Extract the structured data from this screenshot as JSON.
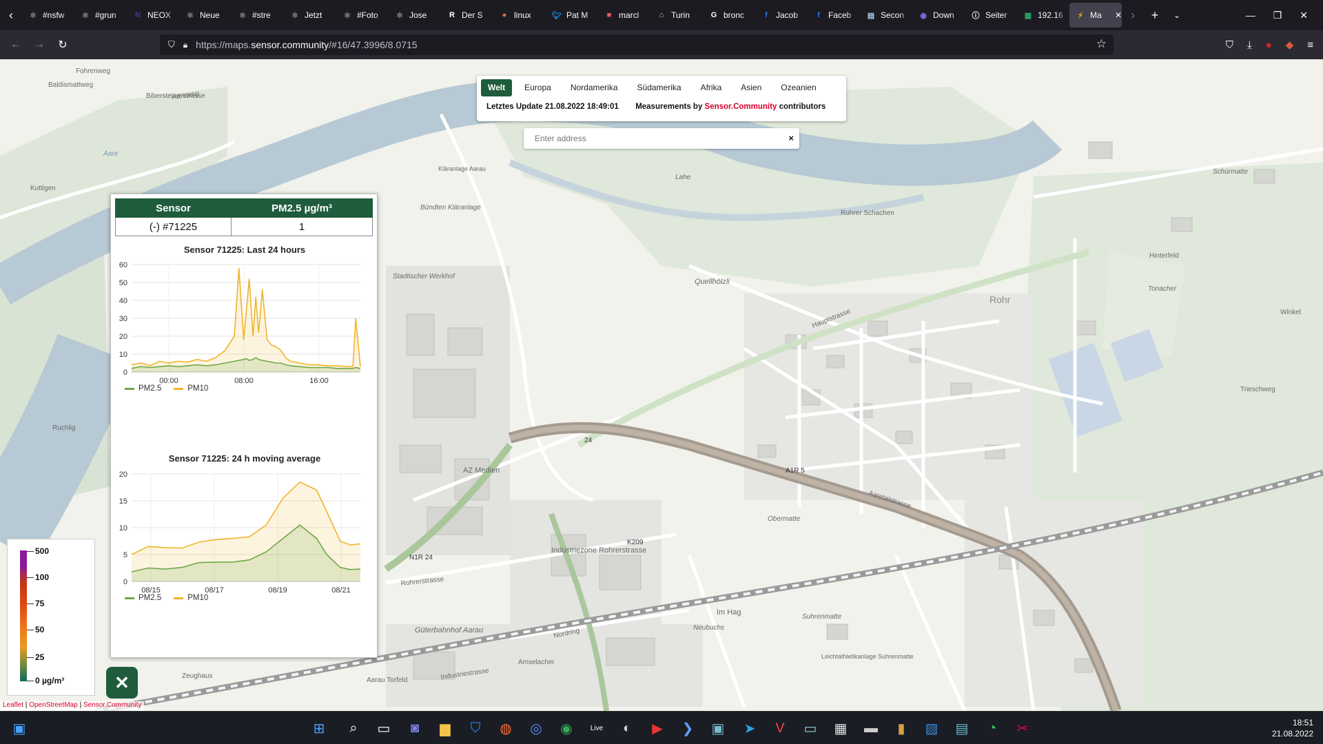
{
  "browser": {
    "tabs": [
      {
        "title": "#nsfw",
        "icon": "spark-icon",
        "color": "#6b6b6b"
      },
      {
        "title": "#grun",
        "icon": "spark-icon",
        "color": "#6b6b6b"
      },
      {
        "title": "NEOX",
        "icon": "neox-icon",
        "color": "#3a3a9a"
      },
      {
        "title": "Neue",
        "icon": "spark-icon",
        "color": "#6b6b6b"
      },
      {
        "title": "#stre",
        "icon": "spark-icon",
        "color": "#6b6b6b"
      },
      {
        "title": "Jetzt",
        "icon": "spark-icon",
        "color": "#6b6b6b"
      },
      {
        "title": "#Foto",
        "icon": "spark-icon",
        "color": "#6b6b6b"
      },
      {
        "title": "Jose",
        "icon": "spark-icon",
        "color": "#6b6b6b"
      },
      {
        "title": "Der S",
        "icon": "r-icon",
        "color": "#ffffff"
      },
      {
        "title": "linux",
        "icon": "circle-icon",
        "color": "#e8733a"
      },
      {
        "title": "Pat M",
        "icon": "twitter-icon",
        "color": "#1d9bf0"
      },
      {
        "title": "marcl",
        "icon": "square-icon",
        "color": "#e85a6a"
      },
      {
        "title": "Turin",
        "icon": "doc-icon",
        "color": "#cccccc"
      },
      {
        "title": "bronc",
        "icon": "google-icon",
        "color": "#ffffff"
      },
      {
        "title": "Jacob",
        "icon": "facebook-icon",
        "color": "#1877f2"
      },
      {
        "title": "Faceb",
        "icon": "facebook-icon",
        "color": "#1877f2"
      },
      {
        "title": "Secon",
        "icon": "page-icon",
        "color": "#a8c8e8"
      },
      {
        "title": "Down",
        "icon": "eye-icon",
        "color": "#7a6cf0"
      },
      {
        "title": "Seiter",
        "icon": "info-icon",
        "color": "#ffffff"
      },
      {
        "title": "192.16",
        "icon": "sheet-icon",
        "color": "#2ea36a"
      },
      {
        "title": "Ma",
        "icon": "bolt-icon",
        "color": "#f2b31a"
      }
    ],
    "url_prefix": "https://maps.",
    "url_domain": "sensor.community",
    "url_path": "/#16/47.3996/8.0715"
  },
  "regions": {
    "tabs": [
      "Welt",
      "Europa",
      "Nordamerika",
      "Südamerika",
      "Afrika",
      "Asien",
      "Ozeanien"
    ],
    "update_label": "Letztes Update 21.08.2022 18:49:01",
    "measure_prefix": "Measurements by",
    "measure_link": "Sensor.Community",
    "measure_suffix": "contributors"
  },
  "search": {
    "placeholder": "Enter address",
    "clear": "×"
  },
  "sensor_table": {
    "col_sensor": "Sensor",
    "col_value": "PM2.5 µg/m³",
    "sensor_id": "(-) #71225",
    "value": "1"
  },
  "chart_data": [
    {
      "type": "line",
      "title": "Sensor 71225: Last 24 hours",
      "x_ticks": [
        "00:00",
        "08:00",
        "16:00"
      ],
      "yticks": [
        0,
        10,
        20,
        30,
        40,
        50,
        60
      ],
      "ylim": [
        0,
        60
      ],
      "x": [
        -6,
        -5,
        -4,
        -3,
        -2,
        -1,
        0,
        1,
        2,
        3,
        4,
        5,
        5.5,
        6,
        6.3,
        6.6,
        7,
        7.3,
        7.6,
        8,
        8.5,
        9,
        9.5,
        10,
        10.5,
        11,
        12,
        13,
        14,
        15,
        16,
        17,
        17.7,
        18,
        18.5
      ],
      "series": [
        {
          "name": "PM2.5",
          "color": "#6ea84a",
          "values": [
            2,
            3,
            2.5,
            3,
            3.5,
            3,
            3.5,
            4,
            3.5,
            4,
            5,
            6,
            6.5,
            7,
            7.5,
            6.5,
            7,
            8,
            7,
            6.5,
            6,
            5.5,
            5,
            5,
            4,
            3.5,
            3,
            2.5,
            2.5,
            2.5,
            2,
            2,
            2,
            2.5,
            2
          ]
        },
        {
          "name": "PM10",
          "color": "#f0b429",
          "values": [
            4,
            5,
            3.5,
            6,
            5,
            6,
            5.5,
            7,
            6,
            8,
            12,
            20,
            58,
            18,
            35,
            52,
            20,
            42,
            22,
            46,
            18,
            15,
            14,
            12,
            8,
            6,
            5,
            4,
            4,
            3.5,
            3.5,
            3,
            3,
            30,
            3
          ]
        }
      ],
      "legend": "bottom-left"
    },
    {
      "type": "area",
      "title": "Sensor 71225: 24 h moving average",
      "x_ticks": [
        "08/15",
        "08/17",
        "08/19",
        "08/21"
      ],
      "yticks": [
        0,
        5,
        10,
        15,
        20
      ],
      "ylim": [
        0,
        20
      ],
      "x": [
        0,
        0.5,
        1,
        1.5,
        2,
        2.5,
        3,
        3.5,
        4,
        4.5,
        5,
        5.5,
        5.8,
        6.2,
        6.5,
        6.8
      ],
      "series": [
        {
          "name": "PM2.5",
          "color": "#6ea84a",
          "values": [
            1.8,
            2.5,
            2.3,
            2.6,
            3.5,
            3.6,
            3.6,
            4,
            5.5,
            8,
            10.5,
            8,
            5,
            2.6,
            2.2,
            2.3
          ]
        },
        {
          "name": "PM10",
          "color": "#f0b429",
          "values": [
            5,
            6.5,
            6.3,
            6.2,
            7.3,
            7.8,
            8,
            8.3,
            10.5,
            15.5,
            18.5,
            17,
            13,
            7.5,
            6.8,
            7
          ]
        }
      ],
      "legend": "bottom-left"
    }
  ],
  "color_scale": {
    "labels": [
      "500",
      "100",
      "75",
      "50",
      "25",
      "0 µg/m³"
    ]
  },
  "attribution": {
    "leaflet": "Leaflet",
    "osm": "OpenStreetMap",
    "sc": "Sensor.Community"
  },
  "map_labels": {
    "l1": "Bibersteinerstrasse",
    "l2": "Aareweg",
    "l3": "Baldismattweg",
    "l4": "Fohrenweg",
    "l5": "Kuttigen",
    "l6": "Aare",
    "l7": "Bündten Kläranlage",
    "l8": "Stadtischer Werkhof",
    "l9": "Quellhölzli",
    "l10": "Rohr",
    "l11": "Hauptstrasse",
    "l12": "Hinterfeld",
    "l13": "Tonacher",
    "l14": "Winkel",
    "l15": "Aaretalstrasse",
    "l16": "AZ Medien",
    "l17": "Industriezone Rohrerstrasse",
    "l18": "Güterbahnhof Aarau",
    "l19": "Im Hag",
    "l20": "Suhrenmatte",
    "l21": "Obermatte",
    "l22": "Rohrer Schachen",
    "l23": "Schürmatte",
    "l24": "Lahe",
    "l25": "Ruchlig",
    "l26": "Zeughaus",
    "l27": "Amselacher",
    "l28": "Neubuchs",
    "l29": "Leichtathletikanlage Suhrenmatte",
    "l30": "Kläranlage Aarau",
    "l31": "K209",
    "l32": "A1R 5",
    "l33": "N1R 24",
    "l34": "24",
    "l35": "Aarau Torfeld",
    "l36": "Industriestrasse",
    "l37": "Nordring",
    "l38": "Rohrerstrasse",
    "l39": "Trieschweg"
  },
  "taskbar": {
    "time": "18:51",
    "date": "21.08.2022"
  }
}
